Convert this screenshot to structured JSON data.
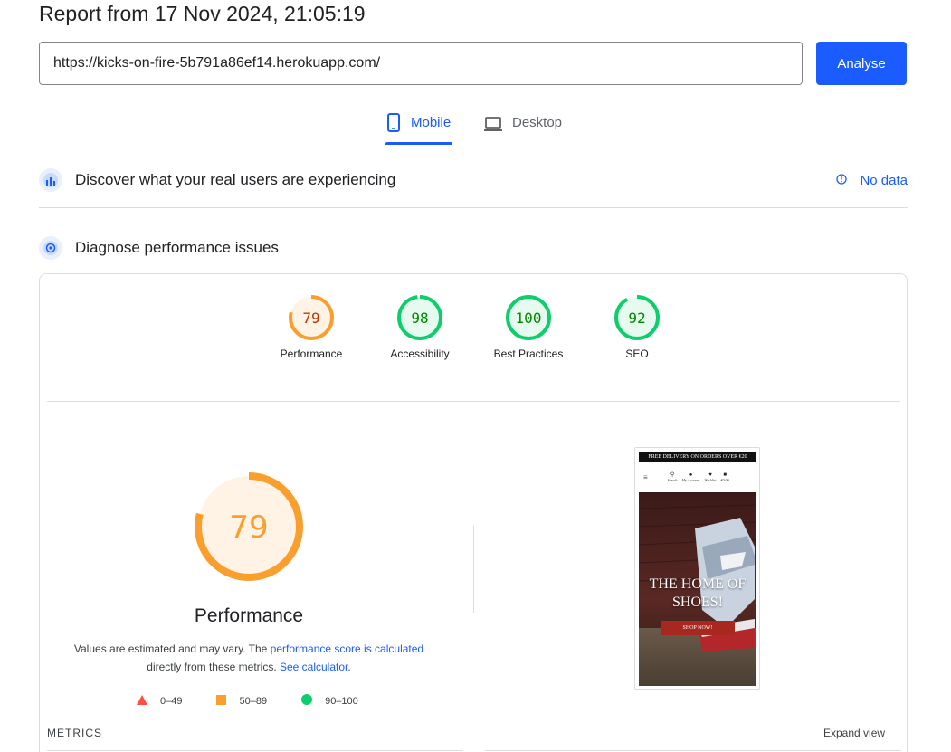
{
  "report": {
    "title": "Report from 17 Nov 2024, 21:05:19"
  },
  "url_bar": {
    "value": "https://kicks-on-fire-5b791a86ef14.herokuapp.com/",
    "analyse_label": "Analyse"
  },
  "tabs": [
    {
      "label": "Mobile",
      "active": true,
      "icon": "phone-icon"
    },
    {
      "label": "Desktop",
      "active": false,
      "icon": "laptop-icon"
    }
  ],
  "field_data": {
    "title": "Discover what your real users are experiencing",
    "status": "No data"
  },
  "diagnose": {
    "title": "Diagnose performance issues"
  },
  "categories": [
    {
      "name": "Performance",
      "score": "79",
      "level": 0.79,
      "color": "#fa9f2d",
      "bg": "#fff3e6",
      "text_color": "#c33300"
    },
    {
      "name": "Accessibility",
      "score": "98",
      "level": 0.98,
      "color": "#0cce6b",
      "bg": "#e6faf0",
      "text_color": "#008800"
    },
    {
      "name": "Best Practices",
      "score": "100",
      "level": 1.0,
      "color": "#0cce6b",
      "bg": "#e6faf0",
      "text_color": "#008800"
    },
    {
      "name": "SEO",
      "score": "92",
      "level": 0.92,
      "color": "#0cce6b",
      "bg": "#e6faf0",
      "text_color": "#008800"
    }
  ],
  "performance": {
    "score": "79",
    "level": 0.79,
    "heading": "Performance",
    "desc_prefix": "Values are estimated and may vary. The ",
    "desc_link": "performance score is calculated",
    "desc_middle": "directly from these metrics. ",
    "desc_link2": "See calculator",
    "desc_suffix": "."
  },
  "legend": [
    {
      "shape": "triangle",
      "label": "0–49",
      "color": "#ff4e42"
    },
    {
      "shape": "square",
      "label": "50–89",
      "color": "#fa9f2d"
    },
    {
      "shape": "circle",
      "label": "90–100",
      "color": "#0cce6b"
    }
  ],
  "screenshot": {
    "banner": "FREE DELIVERY ON ORDERS OVER €20",
    "nav": [
      "Search",
      "My Account",
      "Wishlist",
      "€0.00"
    ],
    "hero_text": "THE HOME OF SHOES!",
    "cta": "SHOP NOW!"
  },
  "metrics": {
    "label": "METRICS",
    "expand": "Expand view"
  },
  "colors": {
    "accent": "#1a5cff",
    "average": "#fa9f2d",
    "pass": "#0cce6b",
    "fail": "#ff4e42"
  }
}
